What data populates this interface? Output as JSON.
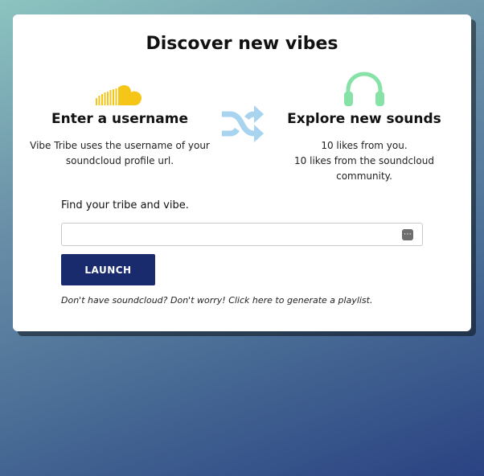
{
  "page": {
    "title": "Discover new vibes"
  },
  "left_column": {
    "heading": "Enter a username",
    "description": "Vibe Tribe uses the username of your soundcloud profile url.",
    "icon": "soundcloud-icon",
    "icon_color": "#f5c518"
  },
  "center": {
    "icon": "shuffle-icon",
    "icon_color": "#a8d4f0"
  },
  "right_column": {
    "heading": "Explore new sounds",
    "line1": "10 likes from you.",
    "line2": "10 likes from the soundcloud community.",
    "icon": "headphones-icon",
    "icon_color": "#86e2a6"
  },
  "form": {
    "label": "Find your tribe and vibe.",
    "input_value": "",
    "input_placeholder": "",
    "launch_label": "LAUNCH",
    "launch_color": "#1a2b6d"
  },
  "footer": {
    "note": "Don't have soundcloud? Don't worry! Click here to generate a playlist."
  }
}
